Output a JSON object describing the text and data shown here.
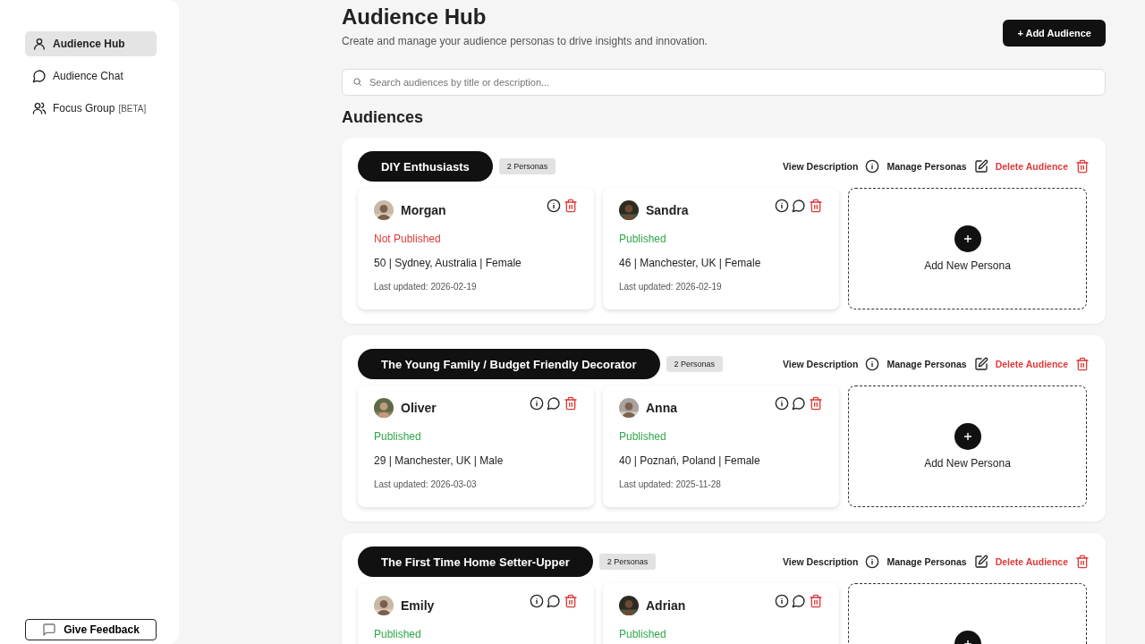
{
  "sidebar": {
    "items": [
      {
        "label": "Audience Hub",
        "selected": true
      },
      {
        "label": "Audience Chat",
        "selected": false
      },
      {
        "label": "Focus Group",
        "tag": "[BETA]",
        "selected": false
      }
    ],
    "feedback_button": "Give Feedback"
  },
  "header": {
    "title": "Audience Hub",
    "subtitle": "Create and manage your audience personas to drive insights and innovation.",
    "add_button": "+ Add Audience"
  },
  "search": {
    "placeholder": "Search audiences by title or description..."
  },
  "section_title": "Audiences",
  "audiences": [
    {
      "title": "DIY Enthusiasts",
      "count": "2 Personas",
      "actions": {
        "view": "View Description",
        "manage": "Manage Personas",
        "delete": "Delete Audience"
      },
      "add_persona": "Add New Persona",
      "personas": [
        {
          "name": "Morgan",
          "chat": false,
          "published": false,
          "status": "Not Published",
          "details": "50 | Sydney, Australia | Female",
          "updated": "Last updated: 2026-02-19"
        },
        {
          "name": "Sandra",
          "chat": true,
          "published": true,
          "status": "Published",
          "details": "46 | Manchester, UK | Female",
          "updated": "Last updated: 2026-02-19"
        }
      ]
    },
    {
      "title": "The Young Family / Budget Friendly Decorator",
      "count": "2 Personas",
      "actions": {
        "view": "View Description",
        "manage": "Manage Personas",
        "delete": "Delete Audience"
      },
      "add_persona": "Add New Persona",
      "personas": [
        {
          "name": "Oliver",
          "chat": true,
          "published": true,
          "status": "Published",
          "details": "29 | Manchester, UK | Male",
          "updated": "Last updated: 2026-03-03"
        },
        {
          "name": "Anna",
          "chat": true,
          "published": true,
          "status": "Published",
          "details": "40 | Poznań, Poland | Female",
          "updated": "Last updated: 2025-11-28"
        }
      ]
    },
    {
      "title": "The First Time Home Setter-Upper",
      "count": "2 Personas",
      "actions": {
        "view": "View Description",
        "manage": "Manage Personas",
        "delete": "Delete Audience"
      },
      "personas": [
        {
          "name": "Emily",
          "chat": true,
          "published": true,
          "status": "Published"
        },
        {
          "name": "Adrian",
          "chat": true,
          "published": true,
          "status": "Published"
        }
      ]
    }
  ]
}
